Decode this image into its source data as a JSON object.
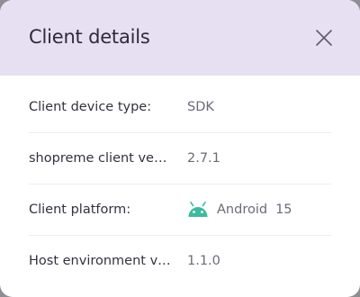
{
  "dialog": {
    "title": "Client details",
    "close_icon": "close-icon"
  },
  "details": [
    {
      "label": "Client device type:",
      "value": "SDK"
    },
    {
      "label": "shopreme client vers…",
      "value": "2.7.1"
    },
    {
      "label": "Client platform:",
      "value": "Android",
      "version": "15",
      "icon": "android-icon",
      "icon_color": "#3dbb9e"
    },
    {
      "label": "Host environment ve…",
      "value": "1.1.0"
    }
  ],
  "colors": {
    "header_background": "#e7e0f2",
    "title": "#2d2a3e",
    "label": "#34313f",
    "value": "#6d6a78",
    "android": "#3dbb9e"
  }
}
